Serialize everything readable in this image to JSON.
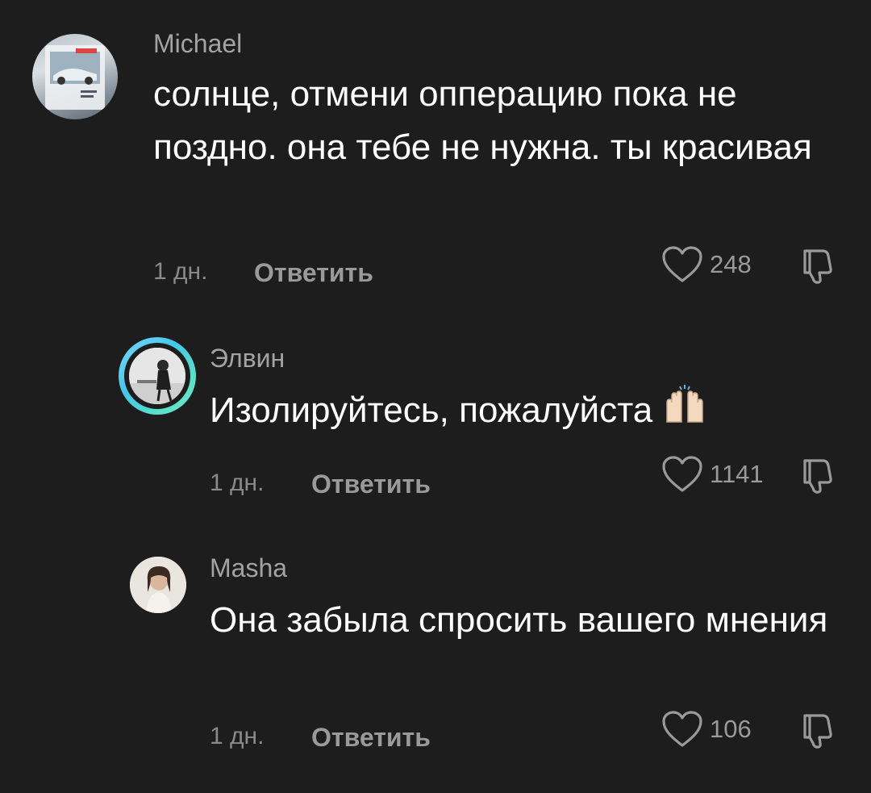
{
  "comments": [
    {
      "username": "Michael",
      "text": "солнце, отмени опперацию пока не поздно. она тебе не нужна. ты красивая",
      "time": "1 дн.",
      "reply_label": "Ответить",
      "likes": "248"
    },
    {
      "username": "Элвин",
      "text": "Изолируйтесь, пожалуйста",
      "emoji": "🙌🏻",
      "time": "1 дн.",
      "reply_label": "Ответить",
      "likes": "1141"
    },
    {
      "username": "Masha",
      "text": "Она забыла спросить вашего мнения",
      "time": "1 дн.",
      "reply_label": "Ответить",
      "likes": "106"
    }
  ],
  "icons": {
    "like": "heart-outline-icon",
    "dislike": "thumbs-down-outline-icon"
  },
  "colors": {
    "background": "#1d1d1d",
    "text": "#ffffff",
    "muted": "#9a9a9a",
    "ring": "#44c7e8"
  }
}
